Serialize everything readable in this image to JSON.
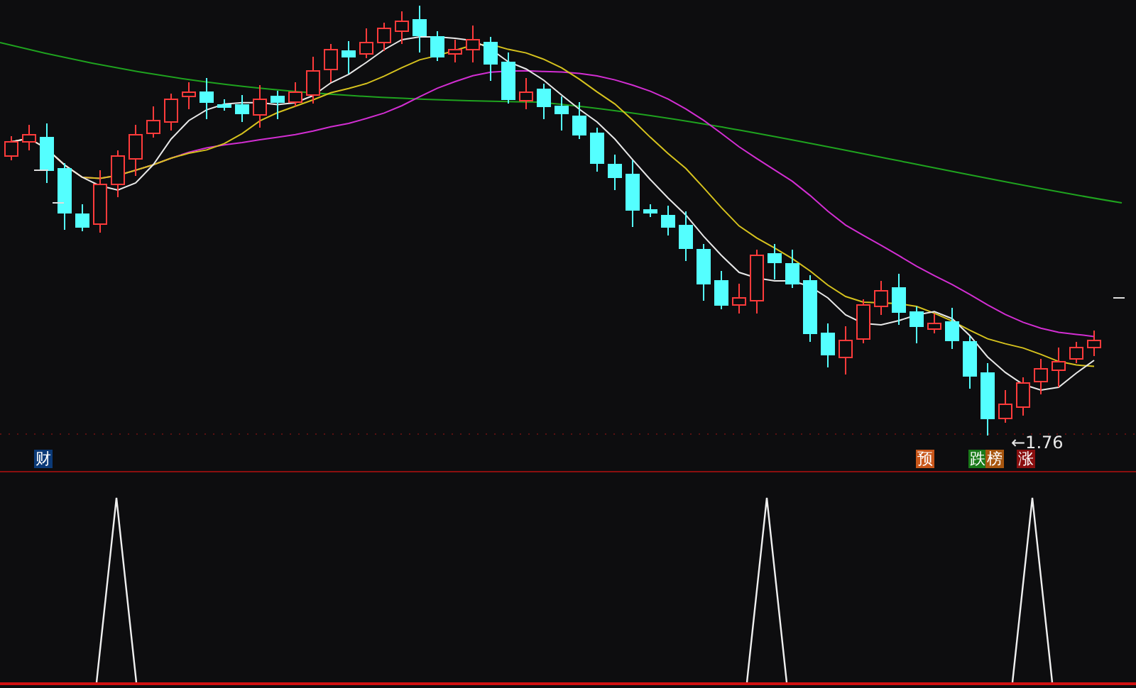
{
  "price_panel": {
    "low_price_label": "←1.76",
    "badges": [
      {
        "label": "财",
        "color": "#0b3a78"
      },
      {
        "label": "预",
        "color": "#c8561a"
      },
      {
        "label": "跌",
        "color": "#1a7a1a"
      },
      {
        "label": "榜",
        "color": "#a8560e"
      },
      {
        "label": "涨",
        "color": "#8a0f0f"
      }
    ]
  }
}
